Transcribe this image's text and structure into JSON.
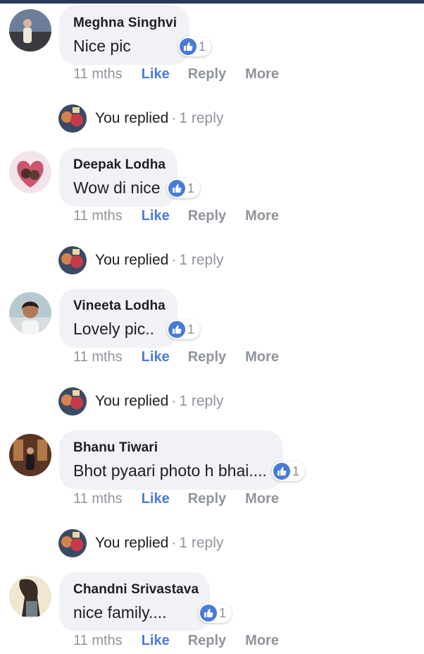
{
  "colors": {
    "accent": "#4a7bd8",
    "bubble": "#f0f2f5",
    "muted": "#90949c",
    "topbar": "#29395a"
  },
  "icons": {
    "reaction": "thumbs-up-icon"
  },
  "comments": [
    {
      "author": "Meghna Singhvi",
      "text": "Nice pic",
      "reactions": "1",
      "time": "11 mths",
      "like": "Like",
      "reply": "Reply",
      "more": "More",
      "replied": {
        "label": "You replied",
        "separator": "·",
        "count": "1 reply"
      }
    },
    {
      "author": "Deepak Lodha",
      "text": "Wow di nice",
      "reactions": "1",
      "time": "11 mths",
      "like": "Like",
      "reply": "Reply",
      "more": "More",
      "replied": {
        "label": "You replied",
        "separator": "·",
        "count": "1 reply"
      }
    },
    {
      "author": "Vineeta Lodha",
      "text": "Lovely pic..",
      "reactions": "1",
      "time": "11 mths",
      "like": "Like",
      "reply": "Reply",
      "more": "More",
      "replied": {
        "label": "You replied",
        "separator": "·",
        "count": "1 reply"
      }
    },
    {
      "author": "Bhanu Tiwari",
      "text": "Bhot pyaari photo h bhai....",
      "reactions": "1",
      "time": "11 mths",
      "like": "Like",
      "reply": "Reply",
      "more": "More",
      "replied": {
        "label": "You replied",
        "separator": "·",
        "count": "1 reply"
      }
    },
    {
      "author": "Chandni Srivastava",
      "text": "nice family....",
      "reactions": "1",
      "time": "11 mths",
      "like": "Like",
      "reply": "Reply",
      "more": "More"
    }
  ]
}
